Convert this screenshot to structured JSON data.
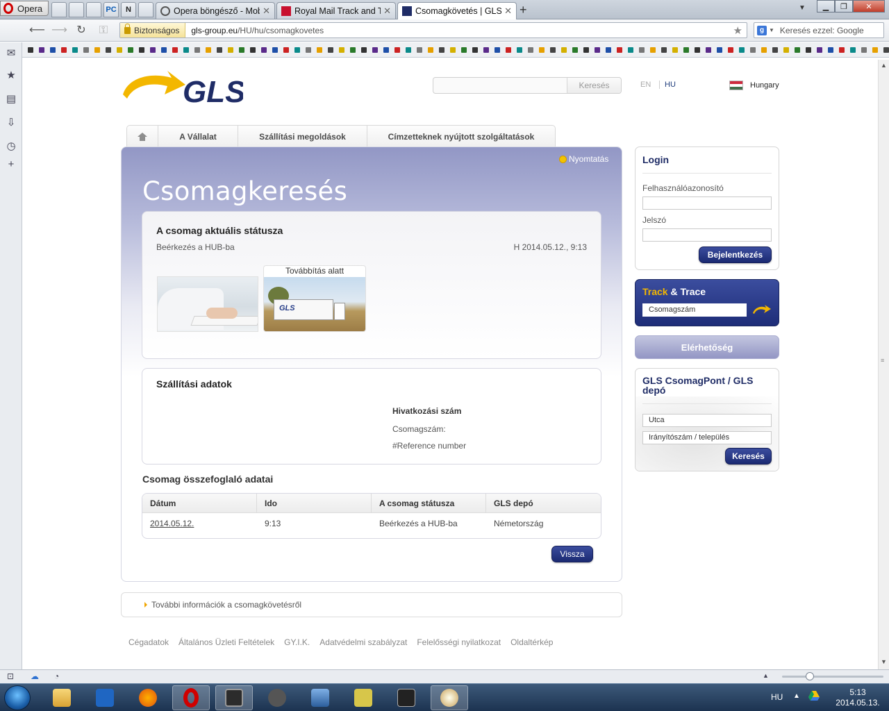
{
  "browser": {
    "menu_label": "Opera",
    "speed_tabs": [
      "",
      "",
      "",
      "PC",
      "N",
      ""
    ],
    "tabs": [
      {
        "title": "Opera böngésző - Mob...",
        "active": false
      },
      {
        "title": "Royal Mail Track and T...",
        "active": false
      },
      {
        "title": "Csomagkövetés | GLS I...",
        "active": true
      }
    ],
    "security_label": "Biztonságos",
    "url_host": "gls-group.eu",
    "url_path": "/HU/hu/csomagkovetes",
    "search_placeholder": "Keresés ezzel: Google",
    "search_engine_icon": "g"
  },
  "header": {
    "search_button": "Keresés",
    "lang_en": "EN",
    "lang_hu": "HU",
    "country": "Hungary"
  },
  "nav": {
    "items": [
      "A Vállalat",
      "Szállítási megoldások",
      "Címzetteknek nyújtott szolgáltatások"
    ]
  },
  "main": {
    "print_label": "Nyomtatás",
    "title": "Csomagkeresés",
    "status": {
      "heading": "A csomag aktuális státusza",
      "text": "Beérkezés a HUB-ba",
      "date": "H 2014.05.12., 9:13",
      "image_label": "Továbbítás alatt"
    },
    "shipment": {
      "heading": "Szállítási adatok",
      "ref_heading": "Hivatkozási szám",
      "parcel_label": "Csomagszám:",
      "reference_label": "#Reference number"
    },
    "summary": {
      "heading": "Csomag összefoglaló adatai",
      "columns": [
        "Dátum",
        "Ido",
        "A csomag státusza",
        "GLS depó"
      ],
      "rows": [
        [
          "2014.05.12.",
          "9:13",
          "Beérkezés a HUB-ba",
          "Németország"
        ]
      ]
    },
    "back_button": "Vissza",
    "more_info": "További információk a csomagkövetésről"
  },
  "footer": {
    "links": [
      "Cégadatok",
      "Általános Üzleti Feltételek",
      "GY.I.K.",
      "Adatvédelmi szabályzat",
      "Felelősségi nyilatkozat",
      "Oldaltérkép"
    ]
  },
  "sidebar": {
    "login": {
      "title": "Login",
      "user_label": "Felhasználóazonosító",
      "password_label": "Jelszó",
      "button": "Bejelentkezés"
    },
    "track": {
      "title_part1": "Track",
      "title_part2": " & Trace",
      "placeholder": "Csomagszám"
    },
    "contact": "Elérhetőség",
    "depot": {
      "title": "GLS CsomagPont / GLS depó",
      "street_placeholder": "Utca",
      "zip_placeholder": "Irányítószám / település",
      "button": "Keresés"
    }
  },
  "taskbar": {
    "language": "HU",
    "time": "5:13",
    "date": "2014.05.13."
  },
  "colors": {
    "gls_blue": "#1f2c66",
    "gls_yellow": "#f3b700",
    "panel_lilac": "#9297c5"
  }
}
